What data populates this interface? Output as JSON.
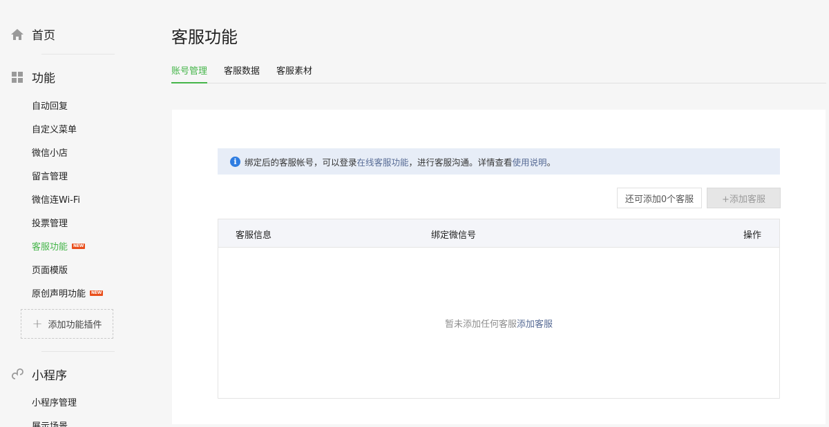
{
  "sidebar": {
    "home_label": "首页",
    "features_label": "功能",
    "feature_items": [
      {
        "label": "自动回复"
      },
      {
        "label": "自定义菜单"
      },
      {
        "label": "微信小店"
      },
      {
        "label": "留言管理"
      },
      {
        "label": "微信连Wi-Fi"
      },
      {
        "label": "投票管理"
      },
      {
        "label": "客服功能",
        "badge": "NEW",
        "active": true
      },
      {
        "label": "页面模版"
      },
      {
        "label": "原创声明功能",
        "badge": "NEW"
      }
    ],
    "add_plugin_label": "添加功能插件",
    "miniprogram_label": "小程序",
    "miniprogram_items": [
      {
        "label": "小程序管理"
      },
      {
        "label": "展示场景"
      }
    ]
  },
  "main": {
    "title": "客服功能",
    "tabs": [
      {
        "label": "账号管理",
        "active": true
      },
      {
        "label": "客服数据"
      },
      {
        "label": "客服素材"
      }
    ],
    "notice": {
      "text_before": "绑定后的客服帐号，可以登录",
      "link1": "在线客服功能",
      "text_middle": "，进行客服沟通。详情查看",
      "link2": "使用说明",
      "text_after": "。"
    },
    "remaining_label": "还可添加0个客服",
    "add_button_label": "+添加客服",
    "table": {
      "headers": [
        "客服信息",
        "绑定微信号",
        "操作"
      ],
      "empty_text": "暂未添加任何客服",
      "empty_link": "添加客服"
    }
  },
  "colors": {
    "accent": "#44b549",
    "link": "#576b95",
    "badge": "#e94e1b",
    "info": "#2f7de1"
  }
}
